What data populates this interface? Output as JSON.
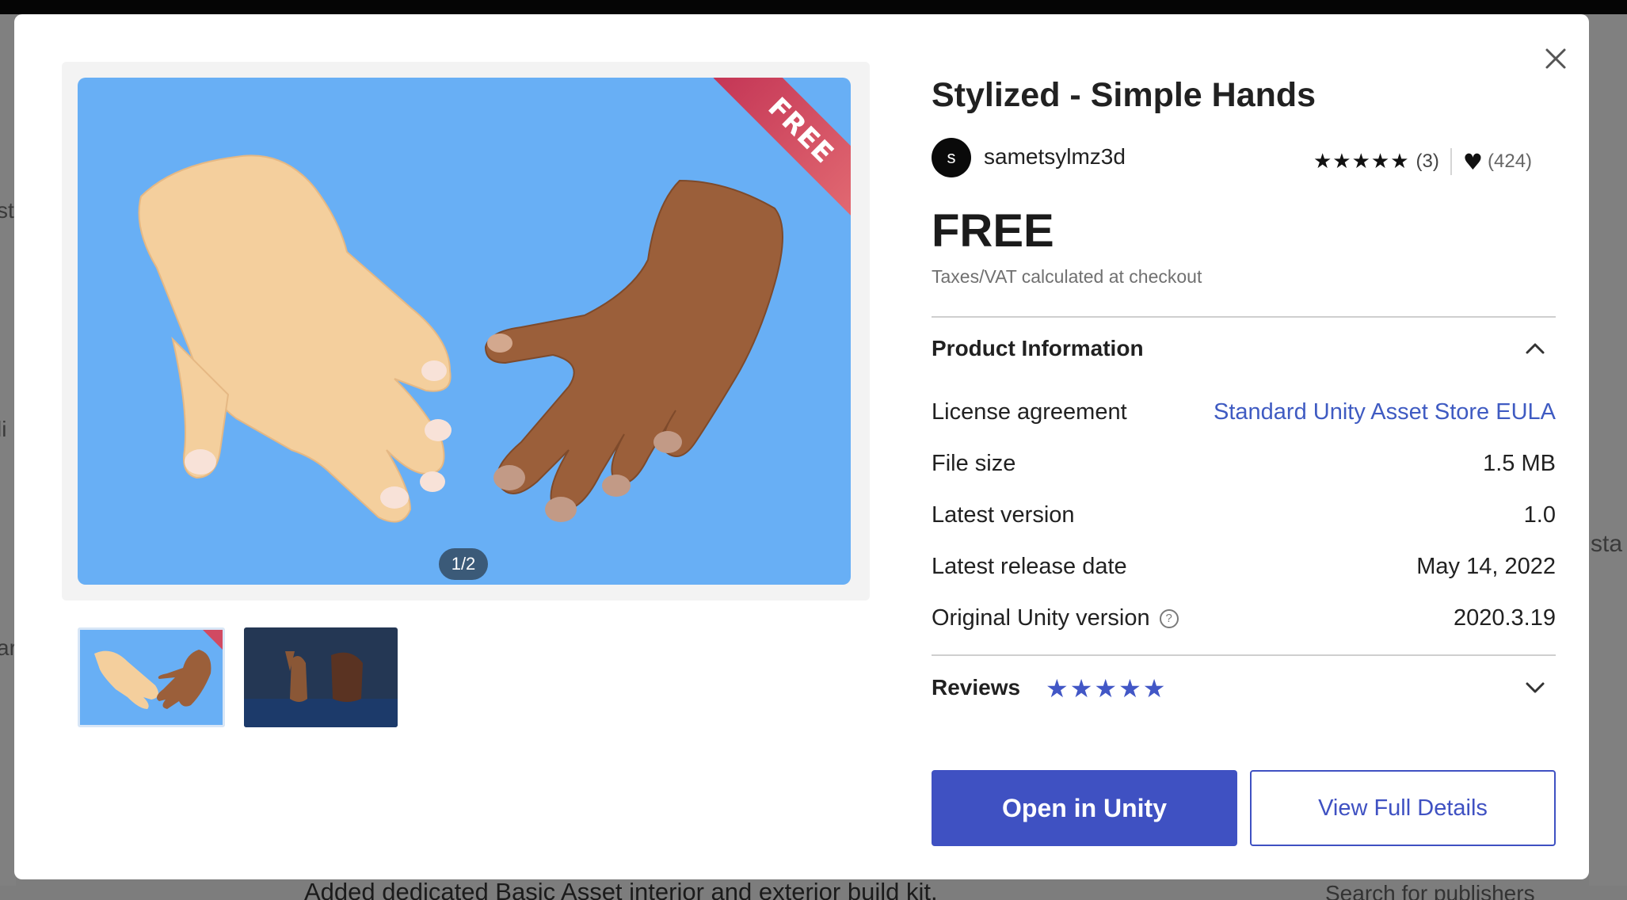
{
  "background": {
    "bottom_text": "Added dedicated Basic Asset interior and exterior build kit.",
    "bottom_right_text": "Search for publishers",
    "left_fragments": [
      "st",
      "li",
      "ar"
    ],
    "right_fragment": "sta"
  },
  "product": {
    "title": "Stylized - Simple Hands",
    "publisher_initial": "s",
    "publisher": "sametsylmz3d",
    "rating_stars": "★★★★★",
    "rating_count": "(3)",
    "heart_icon": "♥",
    "likes_count": "(424)",
    "price": "FREE",
    "tax_note": "Taxes/VAT calculated at checkout"
  },
  "gallery": {
    "ribbon_text": "FREE",
    "page_indicator": "1/2"
  },
  "product_info": {
    "title": "Product Information",
    "rows": [
      {
        "label": "License agreement",
        "value": "Standard Unity Asset Store EULA"
      },
      {
        "label": "File size",
        "value": "1.5 MB"
      },
      {
        "label": "Latest version",
        "value": "1.0"
      },
      {
        "label": "Latest release date",
        "value": "May 14, 2022"
      },
      {
        "label": "Original Unity version",
        "value": "2020.3.19"
      }
    ],
    "help_icon": "?"
  },
  "reviews": {
    "title": "Reviews",
    "stars": "★★★★★"
  },
  "actions": {
    "primary": "Open in Unity",
    "secondary": "View Full Details"
  },
  "colors": {
    "accent": "#3f51c2",
    "link": "#3f5bc2",
    "image_bg": "#68aff5"
  }
}
